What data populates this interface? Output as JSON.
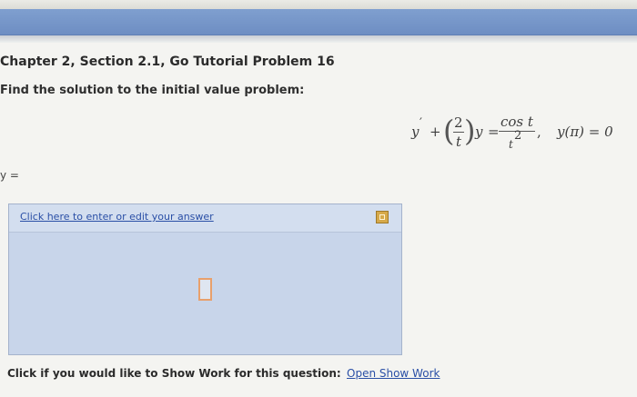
{
  "page": {
    "title": "Chapter 2, Section 2.1, Go Tutorial Problem 16",
    "instruction": "Find the solution to the initial value problem:"
  },
  "equation": {
    "y_prime": "y",
    "prime_mark": "′",
    "plus": "+",
    "coef_numerator": "2",
    "coef_denominator": "t",
    "y_after": "y",
    "equals": "=",
    "rhs_numerator": "cos t",
    "rhs_denominator_base": "t",
    "rhs_denominator_exp": "2",
    "comma": ",",
    "initial_condition": "y(π) = 0"
  },
  "answer": {
    "y_label": "y =",
    "link_text": "Click here to enter or edit your answer"
  },
  "show_work": {
    "prompt": "Click if you would like to Show Work for this question:",
    "link_text": "Open Show Work"
  },
  "colors": {
    "header_bar": "#7f9fcf",
    "answer_panel": "#c8d5ea",
    "link": "#2a4fa6",
    "placeholder_border": "#e8a06c"
  }
}
